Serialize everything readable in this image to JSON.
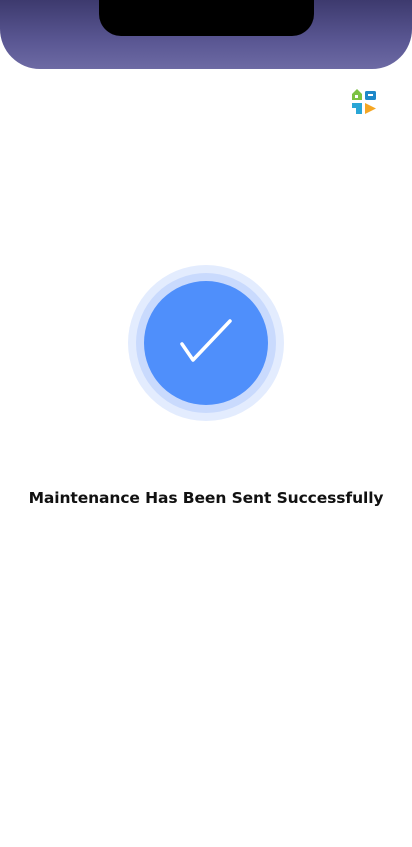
{
  "header": {
    "logo_icon": "app-logo-icon"
  },
  "success": {
    "icon": "checkmark-icon",
    "message": "Maintenance Has Been Sent Successfully"
  },
  "colors": {
    "header_gradient_top": "#3d3a6e",
    "header_gradient_bottom": "#6d6aa4",
    "check_circle": "#4f8ffb",
    "ring_outer": "#e3ecfe",
    "ring_middle": "#c9dafd",
    "logo_green": "#7cc242",
    "logo_blue": "#1e88c9",
    "logo_orange": "#f5a623"
  }
}
